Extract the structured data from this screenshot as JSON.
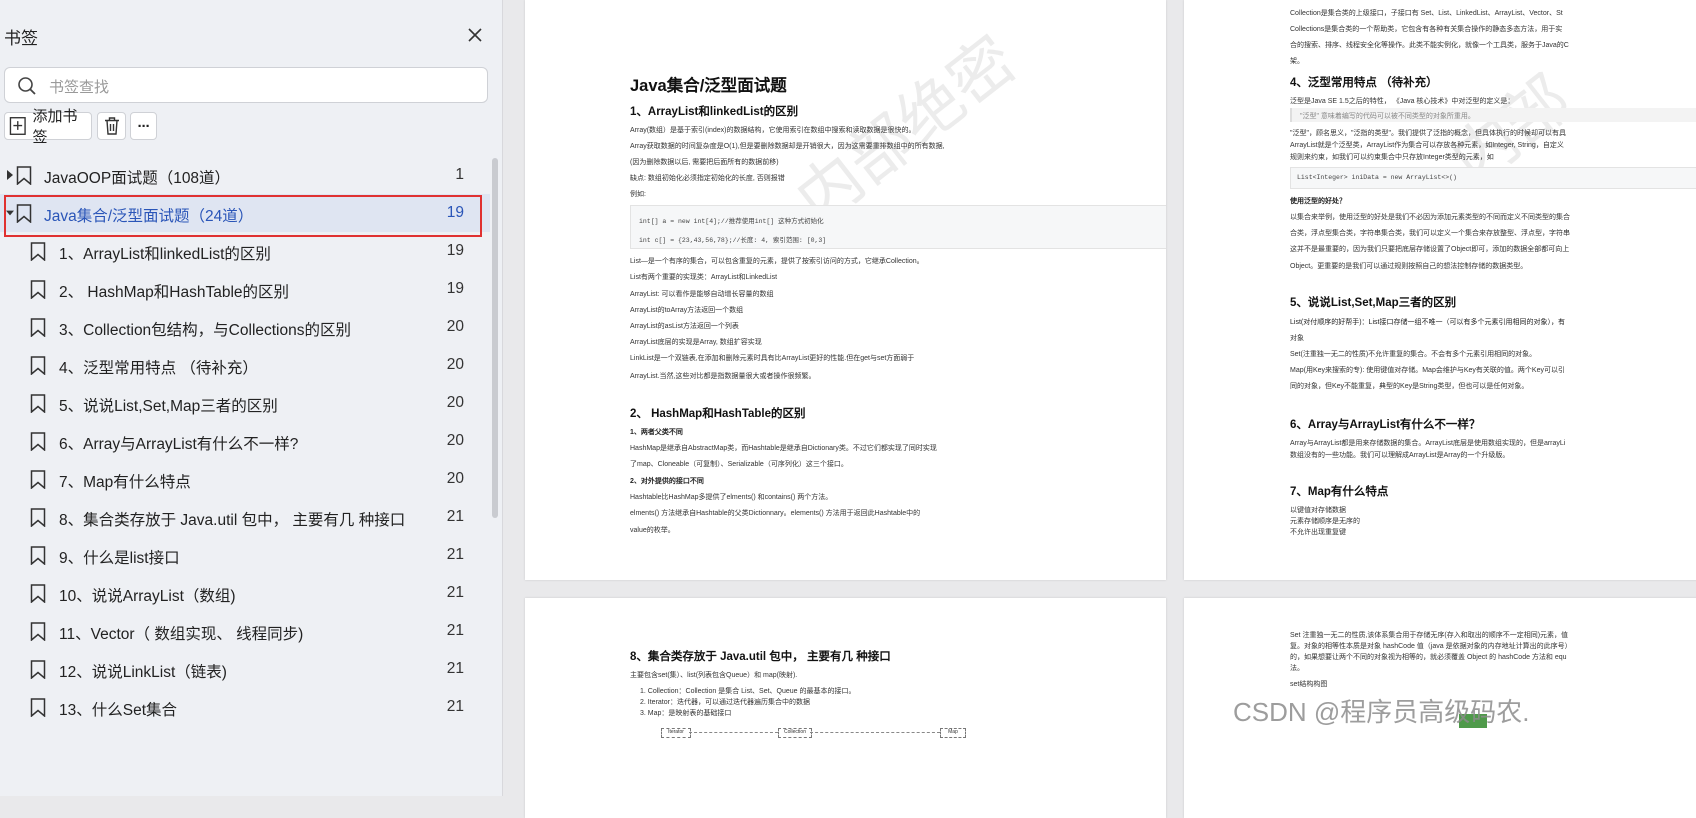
{
  "sidebar": {
    "title": "书签",
    "search_placeholder": "书签查找",
    "add_bookmark_label": "添加书签",
    "more_label": "···",
    "items": [
      {
        "label": "JavaOOP面试题（108道）",
        "page": "1",
        "level": 0,
        "expanded": false
      },
      {
        "label": "Java集合/泛型面试题（24道）",
        "page": "19",
        "level": 0,
        "expanded": true,
        "selected": true
      },
      {
        "label": "1、ArrayList和linkedList的区别",
        "page": "19",
        "level": 1
      },
      {
        "label": "2、 HashMap和HashTable的区别",
        "page": "19",
        "level": 1
      },
      {
        "label": "3、Collection包结构，与Collections的区别",
        "page": "20",
        "level": 1
      },
      {
        "label": "4、泛型常用特点 （待补充）",
        "page": "20",
        "level": 1
      },
      {
        "label": "5、说说List,Set,Map三者的区别",
        "page": "20",
        "level": 1
      },
      {
        "label": "6、Array与ArrayList有什么不一样?",
        "page": "20",
        "level": 1
      },
      {
        "label": "7、Map有什么特点",
        "page": "20",
        "level": 1
      },
      {
        "label": "8、集合类存放于 Java.util 包中， 主要有几 种接口",
        "page": "21",
        "level": 1
      },
      {
        "label": "9、什么是list接口",
        "page": "21",
        "level": 1
      },
      {
        "label": "10、说说ArrayList（数组)",
        "page": "21",
        "level": 1
      },
      {
        "label": "11、Vector（ 数组实现、 线程同步)",
        "page": "21",
        "level": 1
      },
      {
        "label": "12、说说LinkList（链表)",
        "page": "21",
        "level": 1
      },
      {
        "label": "13、什么Set集合",
        "page": "21",
        "level": 1
      }
    ]
  },
  "page1": {
    "title": "Java集合/泛型面试题",
    "h_1": "1、ArrayList和linkedList的区别",
    "p1_l1": "Array(数组）是基于索引(index)的数据结构，它使用索引在数组中搜索和读取数据是很快的。",
    "p1_l2": "Array获取数据的时间复杂度是O(1),但是要删除数据却是开销很大，因为这需要重排数组中的所有数据,",
    "p1_l3": "(因为删除数据以后, 需要把后面所有的数据前移)",
    "p1_l4": "缺点: 数组初始化必须指定初始化的长度, 否则报错",
    "p1_l5": "例如:",
    "code1": "int[] a = new int[4];//推荐使用int[] 这种方式初始化",
    "code2": "int c[] = {23,43,56,78};//长度: 4, 索引范围: [0,3]",
    "p1_l6": "List—是一个有序的集合，可以包含重复的元素，提供了按索引访问的方式，它继承Collection。",
    "p1_l7": "List有两个重要的实现类：ArrayList和LinkedList",
    "p1_l8": "ArrayList: 可以看作是能够自动增长容量的数组",
    "p1_l9": "ArrayList的toArray方法返回一个数组",
    "p1_l10": "ArrayList的asList方法返回一个列表",
    "p1_l11": "ArrayList底层的实现是Array, 数组扩容实现",
    "p1_l12": "LinkList是一个双链表,在添加和删除元素时具有比ArrayList更好的性能.但在get与set方面弱于",
    "p1_l13": "ArrayList.当然,这些对比都是指数据量很大或者操作很频繁。",
    "h_2": "2、 HashMap和HashTable的区别",
    "p1_b1": "1、两者父类不同",
    "p1_l14": "HashMap是继承自AbstractMap类，而Hashtable是继承自Dictionary类。不过它们都实现了同时实现",
    "p1_l15": "了map、Cloneable（可复制）、Serializable（可序列化）这三个接口。",
    "p1_b2": "2、对外提供的接口不同",
    "p1_l16": "Hashtable比HashMap多提供了elments() 和contains() 两个方法。",
    "p1_l17": " elments() 方法继承自Hashtable的父类Dictionnary。elements() 方法用于返回此Hashtable中的",
    "p1_l18": "value的枚举。"
  },
  "page2": {
    "l1": "Collection是集合类的上级接口，子接口有 Set、List、LinkedList、ArrayList、Vector、St",
    "l2": "Collections是集合类的一个帮助类，它包含有各种有关集合操作的静态多态方法，用于实",
    "l3": "合的搜索、排序、线程安全化等操作。此类不能实例化，就像一个工具类，服务于Java的C",
    "l4": "架。",
    "h_4": "4、泛型常用特点 （待补充）",
    "l5": "泛型是Java SE 1.5之后的特性， 《Java 核心技术》中对泛型的定义是：",
    "l6": "\"泛型\" 意味着编写的代码可以被不同类型的对象所重用。",
    "l7": "\"泛型\"，顾名思义，\"泛指的类型\"。我们提供了泛指的概念，但具体执行的时候却可以有具",
    "l8": "ArrayList就是个泛型类，ArrayList作为集合可以存放各种元素，如Integer, String，自定义",
    "l9": "规则来约束，如我们可以约束集合中只存放Integer类型的元素，如",
    "code": "List<Integer> iniData = new ArrayList<>()",
    "b1": "使用泛型的好处？",
    "l10": "以集合来举例，使用泛型的好处是我们不必因为添加元素类型的不同而定义不同类型的集合",
    "l11": "合类，浮点型集合类，字符串集合类，我们可以定义一个集合来存放整型、浮点型，字符串",
    "l12": "这并不是最重要的，因为我们只要把底层存储设置了Object即可，添加的数据全部都可向上",
    "l13": "Object。更重要的是我们可以通过规则按照自己的想法控制存储的数据类型。",
    "h_5": "5、说说List,Set,Map三者的区别",
    "l14": "List(对付顺序的好帮手)：List接口存储一组不唯一（可以有多个元素引用相同的对象），有",
    "l15": "对象",
    "l16": "Set(注重独一无二的性质)不允许重复的集合。不会有多个元素引用相同的对象。",
    "l17": "Map(用Key来搜索的专): 使用键值对存储。Map会维护与Key有关联的值。两个Key可以引",
    "l18": "同的对象，但Key不能重复，典型的Key是String类型，但也可以是任何对象。",
    "h_6": "6、Array与ArrayList有什么不一样？",
    "l19": "Array与ArrayList都是用来存储数据的集合。ArrayList底层是使用数组实现的，但是arrayLi",
    "l20": "数组没有的一些功能。我们可以理解成ArrayList是Array的一个升级版。",
    "h_7": "7、Map有什么特点",
    "l21": "以键值对存储数据",
    "l22": "元素存储顺序是无序的",
    "l23": "不允许出现重复键"
  },
  "page3": {
    "h_8": "8、集合类存放于 Java.util 包中， 主要有几 种接口",
    "l1": "主要包含set(集）、list(列表包含Queue）和 map(映射).",
    "l2": "1. Collection：Collection 是集合 List、Set、Queue 的最基本的接口。",
    "l3": "2. Iterator：迭代器，可以通过迭代器遍历集合中的数据",
    "l4": "3. Map：是映射表的基础接口",
    "d1": "Iterator",
    "d2": "Collection",
    "d3": "Map"
  },
  "page4": {
    "l1": "Set 注重独一无二的性质,该体系集合用于存储无序(存入和取出的顺序不一定相同)元素，值",
    "l2": "复。对象的相等性本质是对象 hashCode 值（java 是依据对象的内存地址计算出的此序号）",
    "l3": "的，如果想要让两个不同的对象视为相等的，就必须覆盖 Object 的 hashCode 方法和 equ",
    "l4": "法。",
    "l5": "set结构构图"
  },
  "watermark": "CSDN @程序员高级码农."
}
